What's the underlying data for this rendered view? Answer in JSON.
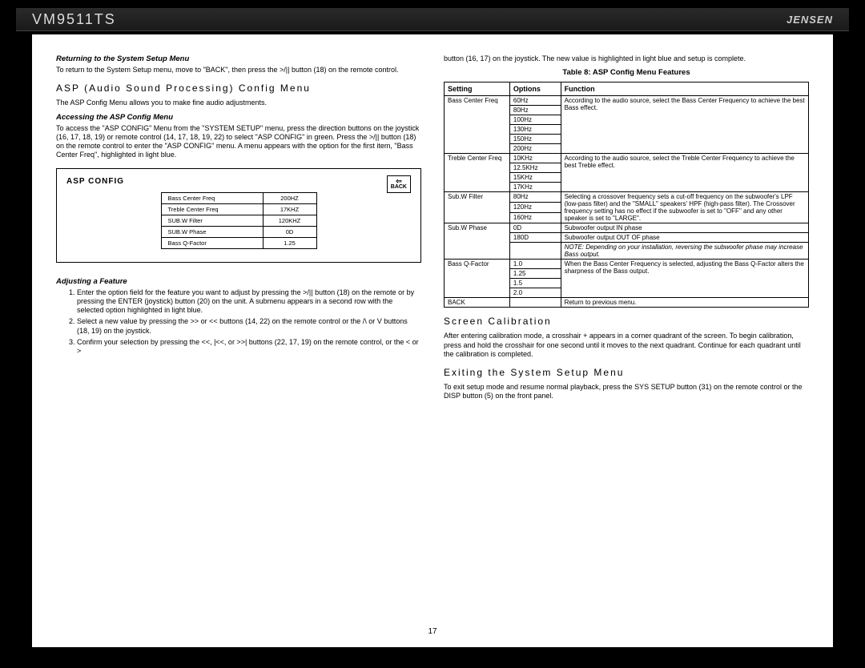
{
  "header": {
    "model": "VM9511TS",
    "brand": "JENSEN"
  },
  "left": {
    "returning_h": "Returning to the System Setup Menu",
    "returning_p": "To return to the System Setup menu, move to \"BACK\", then press the >/|| button (18) on the remote control.",
    "asp_h": "ASP (Audio Sound Processing) Config Menu",
    "asp_p": "The ASP Config Menu allows you to make fine audio adjustments.",
    "access_h": "Accessing the ASP Config Menu",
    "access_p": "To access the \"ASP CONFIG\" Menu from the \"SYSTEM SETUP\" menu, press the direction buttons on the joystick (16, 17, 18, 19) or remote control (14, 17, 18, 19, 22) to select \"ASP CONFIG\" in green. Press the >/|| button (18) on the remote control to enter the \"ASP CONFIG\" menu. A menu appears with the option for the first item, \"Bass Center Freq\", highlighted in light blue.",
    "asp_box": {
      "title": "ASP CONFIG",
      "back": "BACK",
      "rows": [
        [
          "Bass Center Freq",
          "200HZ"
        ],
        [
          "Treble Center Freq",
          "17KHZ"
        ],
        [
          "SUB.W Filter",
          "120KHZ"
        ],
        [
          "SUB.W Phase",
          "0D"
        ],
        [
          "Bass Q-Factor",
          "1.25"
        ]
      ]
    },
    "adjust_h": "Adjusting a Feature",
    "adjust_list": [
      "Enter the option field for the feature you want to adjust by pressing the >/|| button (18) on the remote or by pressing the ENTER (joystick) button (20) on the unit. A submenu appears in a second row with the selected option highlighted in light blue.",
      "Select a new value by pressing the >> or << buttons (14, 22) on the remote control or the /\\ or V buttons (18, 19) on the joystick.",
      "Confirm your selection by pressing the <<, |<<, or >>| buttons (22, 17, 19) on the remote control, or the < or >"
    ]
  },
  "right": {
    "top_p": "button (16, 17) on the joystick. The new value is highlighted in light blue and setup is complete.",
    "table_caption": "Table 8: ASP Config Menu Features",
    "th": [
      "Setting",
      "Options",
      "Function"
    ],
    "rows": [
      {
        "setting": "Bass Center Freq",
        "setting_rowspan": 6,
        "opt": "60Hz",
        "fn": "According to the audio source, select the Bass Center Frequency to achieve the best Bass effect.",
        "fn_rowspan": 6
      },
      {
        "opt": "80Hz"
      },
      {
        "opt": "100Hz"
      },
      {
        "opt": "130Hz"
      },
      {
        "opt": "150Hz"
      },
      {
        "opt": "200Hz"
      },
      {
        "setting": "Treble Center Freq",
        "setting_rowspan": 4,
        "opt": "10KHz",
        "fn": "According to the audio source, select the Treble Center Frequency to achieve the best Treble effect.",
        "fn_rowspan": 4
      },
      {
        "opt": "12.5KHz"
      },
      {
        "opt": "15KHz"
      },
      {
        "opt": "17KHz"
      },
      {
        "setting": "Sub.W Filter",
        "setting_rowspan": 3,
        "opt": "80Hz",
        "fn": "Selecting a crossover frequency sets a cut-off frequency on the subwoofer's LPF (low-pass filter) and the \"SMALL\" speakers' HPF (high-pass filter). The Crossover frequency setting has no effect if the subwoofer is set to \"OFF\" and any other speaker is set to \"LARGE\".",
        "fn_rowspan": 3
      },
      {
        "opt": "120Hz"
      },
      {
        "opt": "160Hz"
      },
      {
        "setting": "Sub.W Phase",
        "setting_rowspan": 3,
        "opt": "0D",
        "fn": "Subwoofer output IN phase"
      },
      {
        "opt": "180D",
        "fn": "Subwoofer output OUT OF phase"
      },
      {
        "opt": "",
        "fn": "NOTE: Depending on your installation, reversing the subwoofer phase may increase Bass output.",
        "note": true
      },
      {
        "setting": "Bass Q-Factor",
        "setting_rowspan": 4,
        "opt": "1.0",
        "fn": "When the Bass Center Frequency is selected, adjusting the Bass Q-Factor alters the sharpness of the Bass output.",
        "fn_rowspan": 4
      },
      {
        "opt": "1.25"
      },
      {
        "opt": "1.5"
      },
      {
        "opt": "2.0"
      },
      {
        "setting": "BACK",
        "opt": "",
        "fn": "Return to previous menu."
      }
    ],
    "screen_h": "Screen Calibration",
    "screen_p": "After entering calibration mode, a crosshair + appears in a corner quadrant of the screen. To begin calibration, press and hold the crosshair for one second until it moves to the next quadrant. Continue for each quadrant until the calibration is completed.",
    "exit_h": "Exiting the System Setup Menu",
    "exit_p": "To exit setup mode and resume normal playback, press the SYS SETUP button (31) on the remote control or the DISP button (5) on the front panel."
  },
  "pagenum": "17"
}
